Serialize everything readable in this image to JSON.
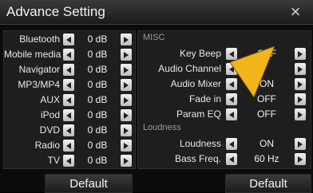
{
  "header": {
    "title": "Advance Setting",
    "close_icon": "×"
  },
  "source_volume": {
    "items": [
      {
        "label": "Bluetooth",
        "value": "0 dB"
      },
      {
        "label": "Mobile media",
        "value": "0 dB"
      },
      {
        "label": "Navigator",
        "value": "0 dB"
      },
      {
        "label": "MP3/MP4",
        "value": "0 dB"
      },
      {
        "label": "AUX",
        "value": "0 dB"
      },
      {
        "label": "iPod",
        "value": "0 dB"
      },
      {
        "label": "DVD",
        "value": "0 dB"
      },
      {
        "label": "Radio",
        "value": "0 dB"
      },
      {
        "label": "TV",
        "value": "0 dB"
      }
    ],
    "default_label": "Default"
  },
  "misc": {
    "section_label": "MISC",
    "items": [
      {
        "label": "Key Beep",
        "value": "OFF"
      },
      {
        "label": "Audio Channel",
        "value": ""
      },
      {
        "label": "Audio Mixer",
        "value": "ON"
      },
      {
        "label": "Fade in",
        "value": "OFF"
      },
      {
        "label": "Param EQ",
        "value": "OFF"
      }
    ]
  },
  "loudness": {
    "section_label": "Loudness",
    "items": [
      {
        "label": "Loudness",
        "value": "ON"
      },
      {
        "label": "Bass Freq.",
        "value": "60 Hz"
      }
    ],
    "default_label": "Default"
  },
  "colors": {
    "accent": "#f2b51c",
    "background": "#0b0b0b",
    "panel": "#1e1e1e"
  }
}
